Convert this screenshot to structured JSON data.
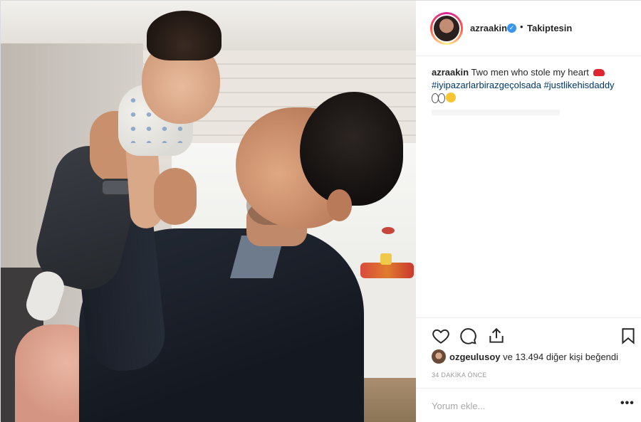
{
  "post": {
    "username": "azraakin",
    "verified_glyph": "✓",
    "separator": "•",
    "follow_label": "Takiptesin"
  },
  "caption": {
    "username": "azraakin",
    "text": "Two men who stole my heart",
    "hashtags": [
      "#iyipazarlarbirazgeçolsada",
      "#justlikehisdaddy"
    ],
    "emojis": [
      "car-emoji",
      "eyes-emoji",
      "star-struck-emoji"
    ]
  },
  "actions": {
    "like_icon": "heart-icon",
    "comment_icon": "comment-icon",
    "share_icon": "share-icon",
    "save_icon": "bookmark-icon"
  },
  "likes": {
    "user": "ozgeulusoy",
    "rest": "ve 13.494 diğer kişi beğendi"
  },
  "timestamp": "34 DAKİKA ÖNCE",
  "comment_box": {
    "placeholder": "Yorum ekle...",
    "more_label": "•••"
  },
  "colors": {
    "verified": "#3897f0",
    "hashtag": "#003569",
    "text": "#262626",
    "muted": "#999999",
    "divider": "#efefef"
  }
}
